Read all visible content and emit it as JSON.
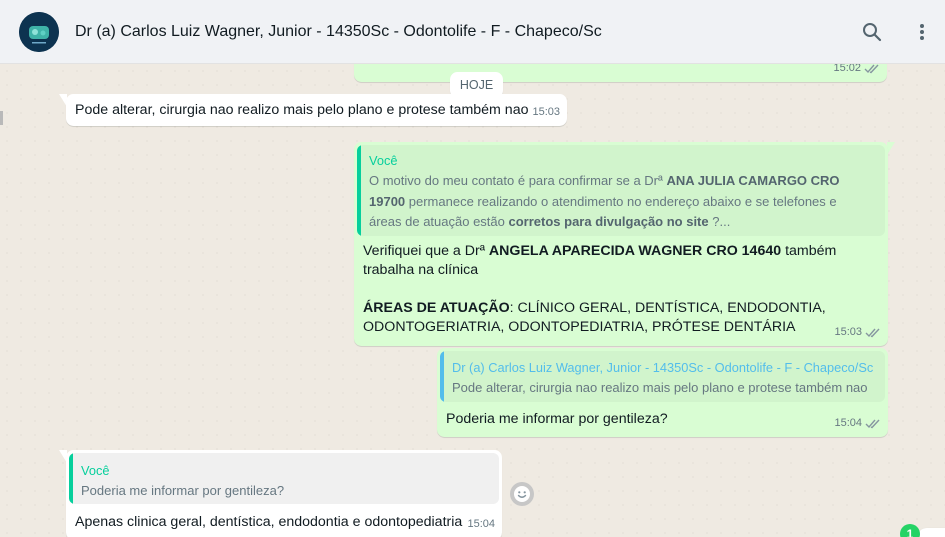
{
  "header": {
    "contact_name": "Dr (a) Carlos Luiz Wagner, Junior - 14350Sc - Odontolife - F - Chapeco/Sc",
    "avatar_icon": "clinic-logo-icon",
    "search_icon": "search-icon",
    "menu_icon": "kebab-menu-icon"
  },
  "colors": {
    "outgoing": "#d9fdd3",
    "incoming": "#ffffff",
    "accent_green": "#06cf9c",
    "quote_bar_blue": "#53bdeb",
    "quote_bar_green": "#06cf9c",
    "unread_badge": "#25d366"
  },
  "date_chip": "HOJE",
  "messages": {
    "m0": {
      "time": "15:02"
    },
    "m1": {
      "text": "Pode alterar, cirurgia nao realizo mais pelo plano e protese também nao",
      "time": "15:03"
    },
    "m2": {
      "quote_author": "Você",
      "quote_p1": "O motivo do meu contato é para confirmar se a Drª ",
      "quote_b1": "ANA JULIA CAMARGO CRO 19700",
      "quote_p2": "  permanece realizando o atendimento no endereço abaixo e se telefones e áreas de atuação estão ",
      "quote_b2": "corretos para divulgação no site",
      "quote_p3": " ?...",
      "line1_a": "Verifiquei que a Drª ",
      "line1_b": "ANGELA APARECIDA WAGNER CRO 14640",
      "line1_c": " também trabalha na clínica",
      "line2_a": "ÁREAS DE ATUAÇÃO",
      "line2_b": ": CLÍNICO GERAL, DENTÍSTICA, ENDODONTIA, ODONTOGERIATRIA, ODONTOPEDIATRIA, PRÓTESE DENTÁRIA",
      "time": "15:03"
    },
    "m3": {
      "quote_author": "Dr (a) Carlos Luiz Wagner, Junior - 14350Sc - Odontolife - F - Chapeco/Sc",
      "quote_text": "Pode alterar, cirurgia nao realizo mais pelo plano e protese também nao",
      "text": "Poderia me informar por gentileza?",
      "time": "15:04"
    },
    "m4": {
      "quote_author": "Você",
      "quote_text": "Poderia me informar por gentileza?",
      "text": "Apenas clinica geral, dentística, endodontia e odontopediatria",
      "time": "15:04"
    }
  },
  "unread_count": "1"
}
